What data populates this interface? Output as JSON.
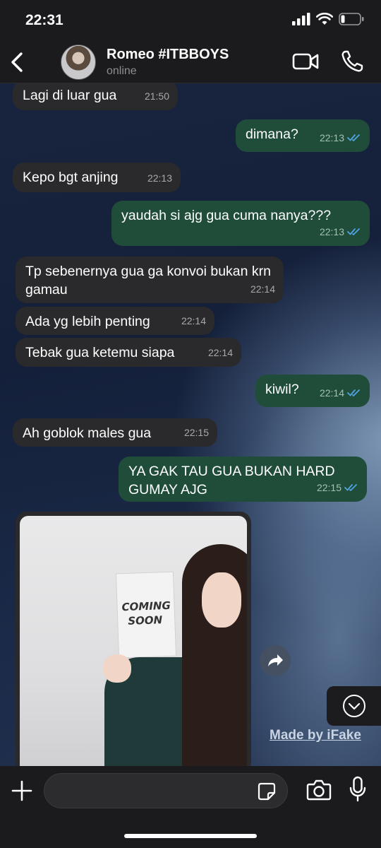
{
  "status_bar": {
    "time": "22:31",
    "battery_level": 0.2
  },
  "header": {
    "back_icon": "chevron-left-icon",
    "contact_name": "Romeo #ITBBOYS",
    "contact_status": "online",
    "video_icon": "video-camera-icon",
    "call_icon": "phone-icon"
  },
  "messages": [
    {
      "direction": "incoming",
      "text": "Lagi di luar gua",
      "time": "21:50"
    },
    {
      "direction": "outgoing",
      "text": "dimana?",
      "time": "22:13",
      "read": true
    },
    {
      "direction": "incoming",
      "text": "Kepo bgt anjing",
      "time": "22:13"
    },
    {
      "direction": "outgoing",
      "text": "yaudah si ajg gua cuma nanya???",
      "time": "22:13",
      "read": true
    },
    {
      "direction": "incoming",
      "text": "Tp sebenernya gua ga konvoi bukan krn gamau",
      "time": "22:14"
    },
    {
      "direction": "incoming",
      "text": "Ada yg lebih penting",
      "time": "22:14"
    },
    {
      "direction": "incoming",
      "text": "Tebak gua ketemu siapa",
      "time": "22:14"
    },
    {
      "direction": "outgoing",
      "text": "kiwil?",
      "time": "22:14",
      "read": true
    },
    {
      "direction": "incoming",
      "text": "Ah goblok males gua",
      "time": "22:15"
    },
    {
      "direction": "outgoing",
      "text": "YA GAK TAU GUA BUKAN HARD GUMAY AJG",
      "time": "22:15",
      "read": true
    }
  ],
  "media_message": {
    "direction": "incoming",
    "poster_text": [
      "COMING",
      "SOON"
    ]
  },
  "floating": {
    "forward_icon": "forward-arrow-icon",
    "scroll_icon": "chevron-down-circle-icon"
  },
  "watermark": "Made by iFake",
  "input": {
    "plus_icon": "plus-icon",
    "value": "",
    "placeholder": "",
    "sticker_icon": "sticker-icon",
    "camera_icon": "camera-icon",
    "mic_icon": "microphone-icon"
  },
  "colors": {
    "incoming_bubble": "#2a2a2c",
    "outgoing_bubble": "#1f4d3a",
    "read_ticks": "#4fa3e0"
  }
}
